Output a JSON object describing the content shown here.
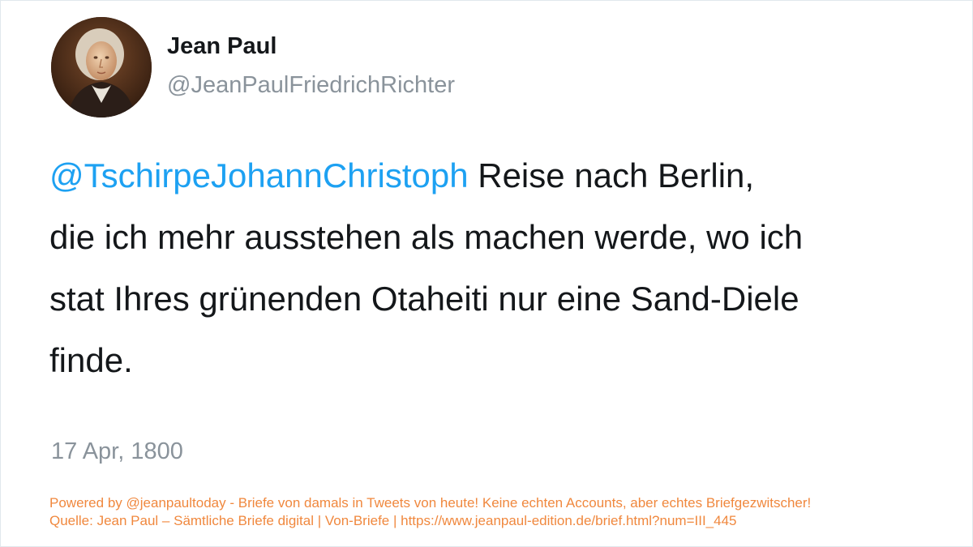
{
  "profile": {
    "display_name": "Jean Paul",
    "handle": "@JeanPaulFriedrichRichter",
    "avatar_icon": "portrait-avatar"
  },
  "tweet": {
    "mention": "@TschirpeJohannChristoph",
    "line1_text": " Reise nach Berlin,",
    "line2": "die ich mehr ausstehen als machen werde, wo ich",
    "line3": "stat Ihres grünenden Otaheiti nur eine Sand-Diele",
    "line4": "finde.",
    "date": "17 Apr, 1800"
  },
  "footer": {
    "powered_by": "Powered by @jeanpaultoday - Briefe von damals in Tweets von heute! Keine echten Accounts, aber echtes Briefgezwitscher!",
    "source": "Quelle: Jean Paul – Sämtliche Briefe digital | Von-Briefe | https://www.jeanpaul-edition.de/brief.html?num=III_445"
  },
  "colors": {
    "mention": "#1da1f2",
    "footer": "#f0883e",
    "muted": "#8a939b"
  }
}
